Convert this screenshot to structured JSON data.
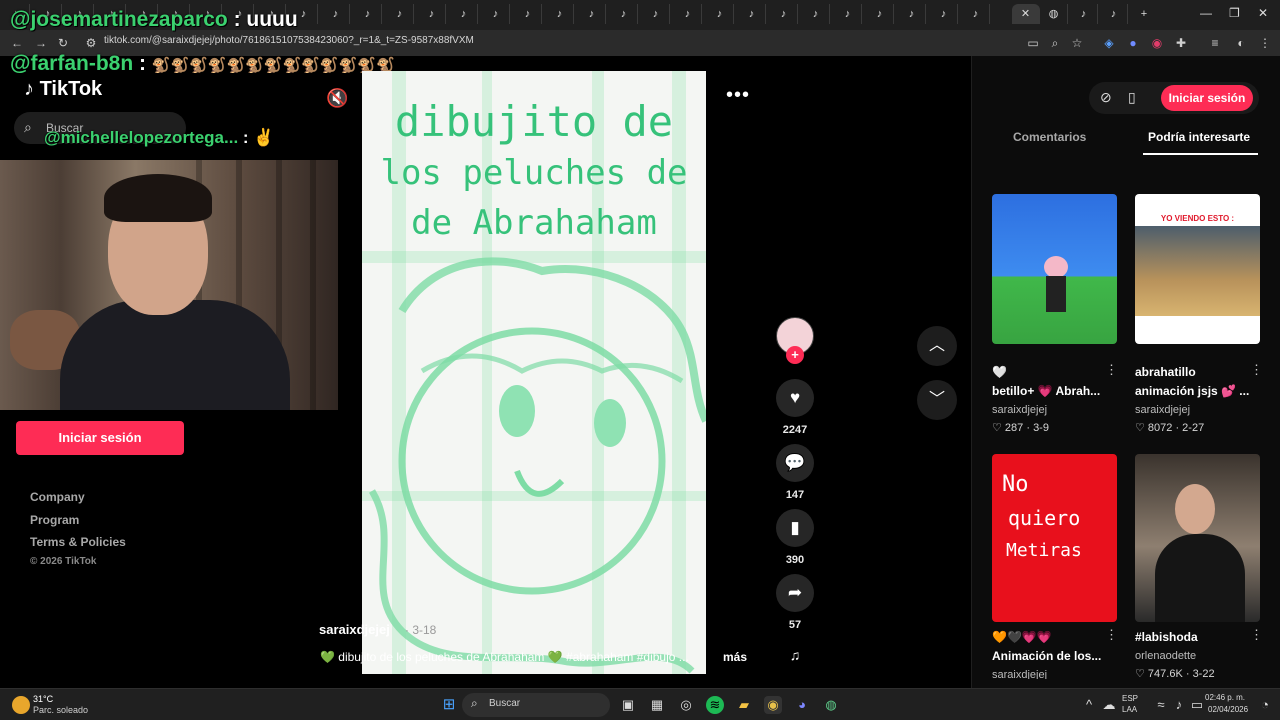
{
  "browser": {
    "url": "tiktok.com/@saraixdjejej/photo/7618615107538423060?_r=1&_t=ZS-9587x88fVXM"
  },
  "stream_chat": [
    {
      "user": "@josemartinezaparco",
      "sep": " : ",
      "message": "uuuu"
    },
    {
      "user": "@farfan-b8n",
      "sep": " : ",
      "message": "🐒🐒🐒🐒🐒🐒🐒🐒🐒🐒🐒🐒🐒"
    },
    {
      "user": "@michellelopezortega...",
      "sep": " : ",
      "message": "✌"
    }
  ],
  "sidebar": {
    "logo": "TikTok",
    "search_placeholder": "Buscar",
    "login_button": "Iniciar sesión",
    "footer_links": [
      "Company",
      "Program",
      "Terms & Policies"
    ],
    "copyright": "© 2026 TikTok"
  },
  "video": {
    "title_lines": [
      "dibujito de",
      "los peluches de",
      "de Abrahaham"
    ],
    "author": "saraixdjejej",
    "date": "· 3-18",
    "caption": "💚 dibujito de los peluches de Abrahaham 💚 #abrahaham #dibujo ...",
    "more": "más"
  },
  "actions": {
    "likes": "2247",
    "comments": "147",
    "saves": "390",
    "shares": "57"
  },
  "right_panel": {
    "login_button": "Iniciar sesión",
    "tabs": [
      "Comentarios",
      "Podría interesarte"
    ],
    "cards": [
      {
        "title": "🤍",
        "subtitle": "betillo+ 💗 Abrah...",
        "user": "saraixdjejej",
        "likes": "♡ 287",
        "date": "3-9"
      },
      {
        "title": "abrahatillo",
        "subtitle": "animación jsjs 💕 ...",
        "user": "saraixdjejej",
        "likes": "♡ 8072",
        "date": "2-27"
      },
      {
        "title": "🧡🖤💗💗",
        "subtitle": "Animación de los...",
        "user": "saraixdjejej",
        "likes": "",
        "date": "",
        "thumb_text": [
          "No",
          "quiero",
          "Metiras"
        ]
      },
      {
        "title": "#labishoda",
        "subtitle": "",
        "user": "orlenaodette",
        "likes": "♡ 747.6K",
        "date": "3-22"
      }
    ],
    "card2_header": "YO VIENDO ESTO :"
  },
  "taskbar": {
    "weather_temp": "31°C",
    "weather_desc": "Parc. soleado",
    "search": "Buscar",
    "lang_top": "ESP",
    "lang_bottom": "LAA",
    "time": "02:46 p. m.",
    "date": "02/04/2026"
  },
  "colors": {
    "brand": "#fe2c55",
    "chat_user": "#3bd16f",
    "drawing": "#36c27a"
  }
}
